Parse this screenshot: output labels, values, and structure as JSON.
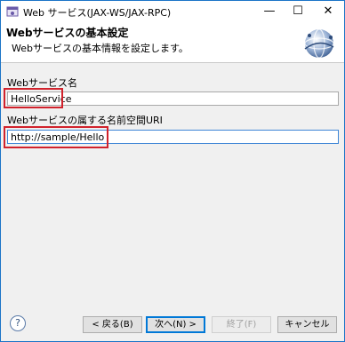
{
  "window": {
    "title": "Web サービス(JAX-WS/JAX-RPC)",
    "minimize_glyph": "—",
    "maximize_glyph": "☐",
    "close_glyph": "✕"
  },
  "banner": {
    "title": "Webサービスの基本設定",
    "description": "Webサービスの基本情報を設定します。",
    "icon": "globe-icon"
  },
  "form": {
    "service_name_label": "Webサービス名",
    "service_name_value": "HelloService",
    "namespace_label": "Webサービスの属する名前空間URI",
    "namespace_value": "http://sample/Hello"
  },
  "buttons": {
    "help": "?",
    "back": "< 戻る(B)",
    "next": "次へ(N) >",
    "finish": "終了(F)",
    "cancel": "キャンセル"
  },
  "colors": {
    "highlight": "#d1222c",
    "focus_border": "#0078d7",
    "window_border": "#1c74c7"
  }
}
